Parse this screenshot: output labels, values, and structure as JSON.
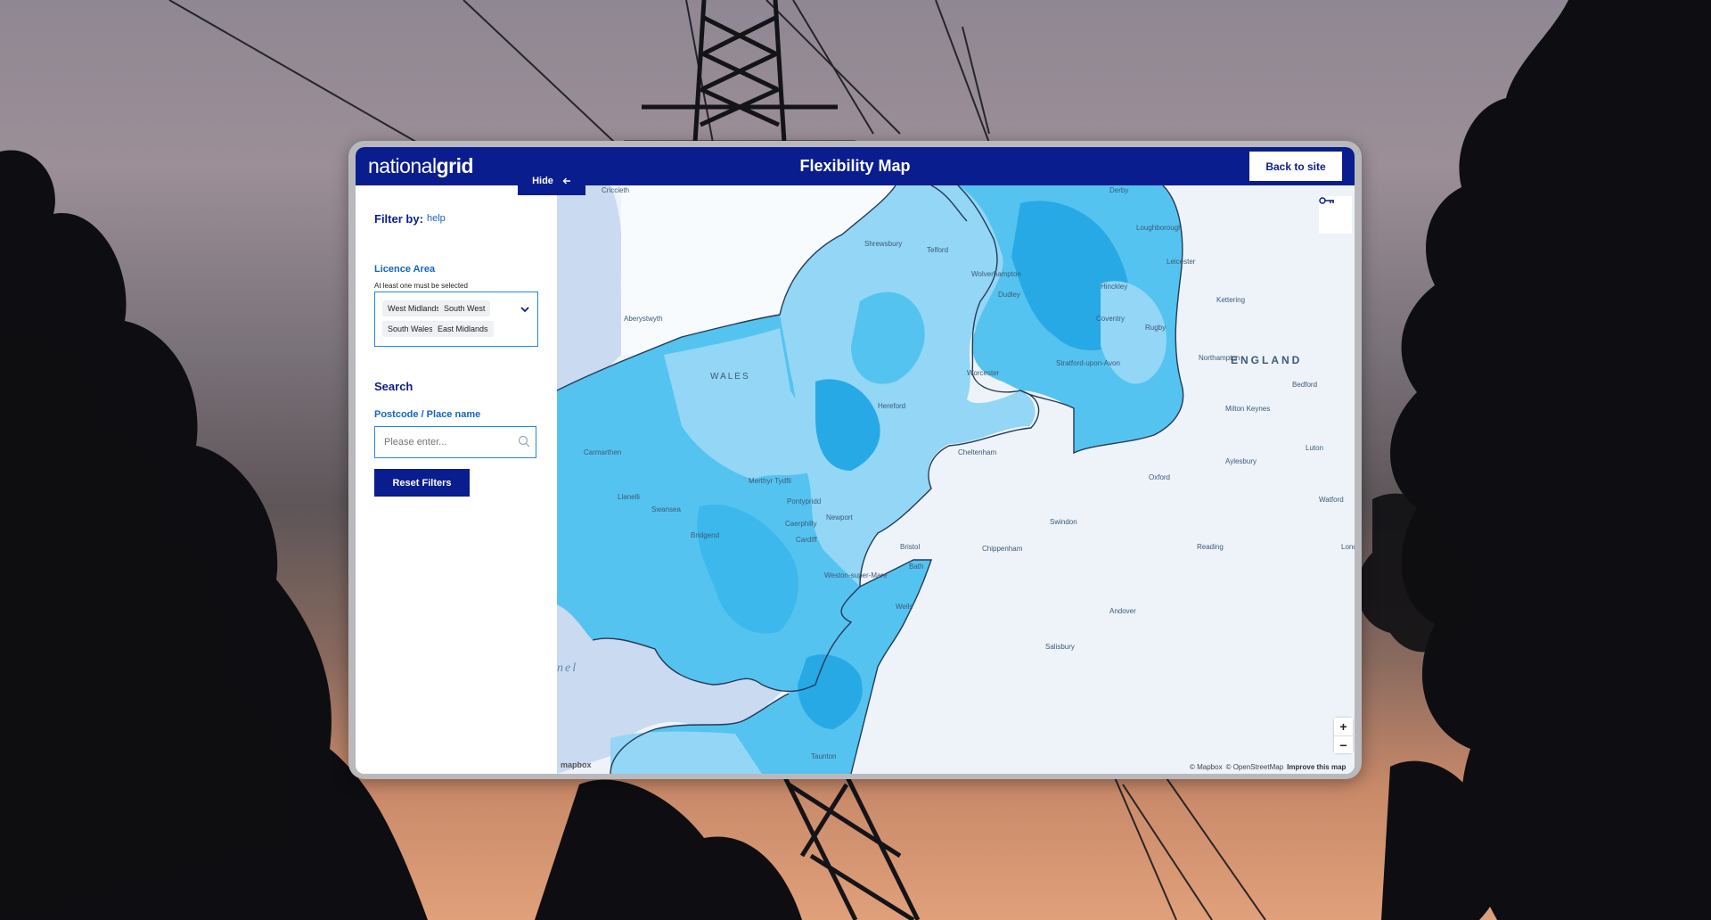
{
  "header": {
    "logo_light": "national",
    "logo_bold": "grid",
    "title": "Flexibility Map",
    "back_label": "Back to site"
  },
  "panel": {
    "filter_label": "Filter by:",
    "help_label": "help",
    "hide_label": "Hide",
    "licence_label": "Licence Area",
    "licence_hint": "At least one must be selected",
    "licence_chips": [
      "West Midlands",
      "South West",
      "South Wales",
      "East Midlands"
    ],
    "search_heading": "Search",
    "postcode_label": "Postcode / Place name",
    "postcode_placeholder": "Please enter...",
    "postcode_value": "",
    "reset_label": "Reset Filters"
  },
  "map": {
    "region_labels": [
      "WALES",
      "ENGLAND"
    ],
    "places": [
      "Criccieth",
      "Derby",
      "Shrewsbury",
      "Telford",
      "Loughborough",
      "Wolverhampton",
      "Leicester",
      "Dudley",
      "Hinckley",
      "Aberystwyth",
      "Coventry",
      "Rugby",
      "Kettering",
      "Worcester",
      "Stratford-upon-Avon",
      "Northampton",
      "Bedford",
      "Hereford",
      "Milton Keynes",
      "Cheltenham",
      "Luton",
      "Carmarthen",
      "Aylesbury",
      "Oxford",
      "Merthyr Tydfil",
      "Llanelli",
      "Swansea",
      "Pontypridd",
      "Newport",
      "Watford",
      "Caerphilly",
      "Bridgend",
      "Cardiff",
      "Swindon",
      "Chippenham",
      "Bristol",
      "Reading",
      "Lond",
      "Weston-super-Mare",
      "Bath",
      "Wells",
      "Andover",
      "Salisbury",
      "Taunton"
    ],
    "sea_label": "nel",
    "legend_icon": "key-icon",
    "zoom_in": "+",
    "zoom_out": "−",
    "attribution": [
      "© Mapbox",
      "© OpenStreetMap",
      "Improve this map"
    ],
    "mapbox_logo": "mapbox",
    "colors": {
      "deep": "#27a9e6",
      "mid": "#55c3ef",
      "light": "#93d6f5",
      "pale": "#c2e7f9",
      "land": "#edf3f9",
      "sea": "#c9daf1",
      "boundary": "#243a58"
    }
  },
  "colors": {
    "brand": "#0a1d8f",
    "link": "#1565c0",
    "field_border": "#1e88e5"
  }
}
